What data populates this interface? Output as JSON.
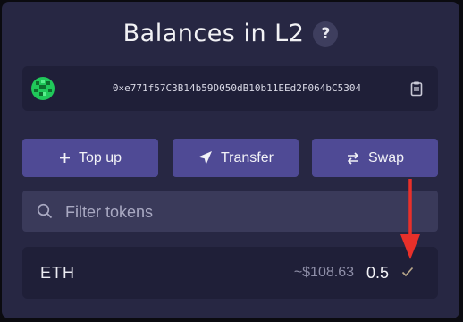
{
  "header": {
    "title": "Balances in L2",
    "help_label": "?"
  },
  "account": {
    "address": "0×e771f57C3B14b59D050dB10b11EEd2F064bC5304"
  },
  "actions": {
    "top_up_label": "Top up",
    "transfer_label": "Transfer",
    "swap_label": "Swap"
  },
  "filter": {
    "placeholder": "Filter tokens",
    "value": ""
  },
  "tokens": [
    {
      "symbol": "ETH",
      "usd_value": "~$108.63",
      "amount": "0.5"
    }
  ],
  "colors": {
    "panel": "#272743",
    "button": "#4f4a95",
    "annotation_arrow": "#e8302a",
    "check": "#b8a78a"
  }
}
